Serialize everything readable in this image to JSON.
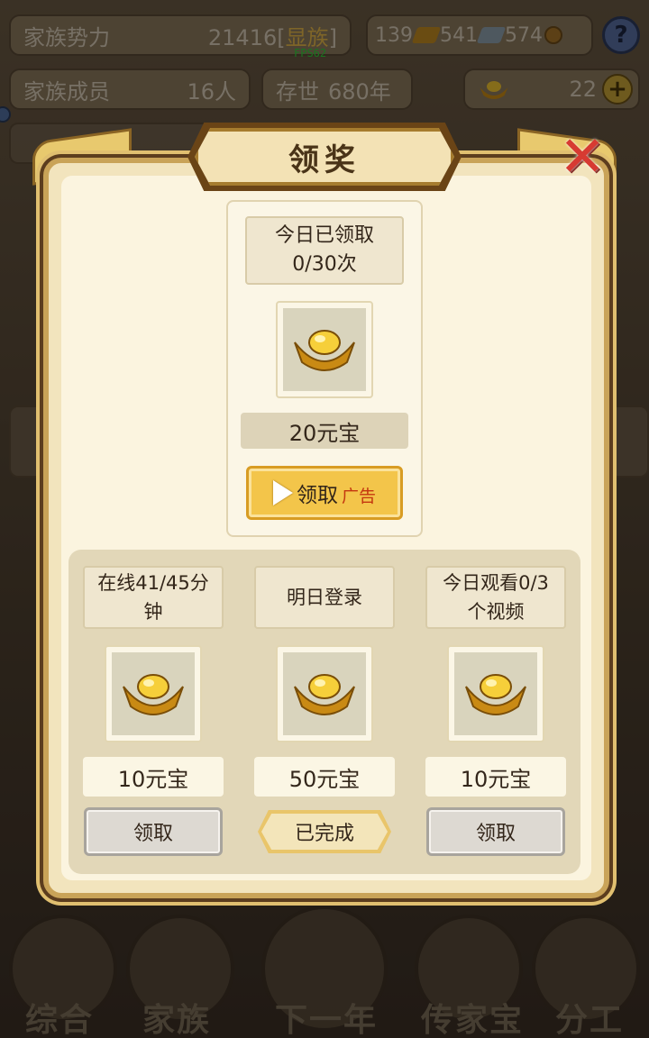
{
  "status": {
    "family_power_label": "家族势力",
    "family_power_value": "21416",
    "family_power_rank": "显族",
    "res_gold": "139",
    "res_silver": "541",
    "res_coin": "574",
    "members_label": "家族成员",
    "members_value": "16人",
    "existence_label": "存世",
    "existence_value": "680年",
    "ingot_count": "22",
    "fps": "FPS62"
  },
  "modal": {
    "title": "领奖",
    "main": {
      "today_claimed": "今日已领取",
      "today_count": "0/30次",
      "reward": "20元宝",
      "button_label": "领取",
      "button_tag": "广告"
    },
    "tasks": [
      {
        "line1": "在线41/45分",
        "line2": "钟",
        "reward": "10元宝",
        "action": "领取",
        "status": "available"
      },
      {
        "line1": "明日登录",
        "line2": "",
        "reward": "50元宝",
        "action": "已完成",
        "status": "done"
      },
      {
        "line1": "今日观看0/3",
        "line2": "个视频",
        "reward": "10元宝",
        "action": "领取",
        "status": "available"
      }
    ]
  },
  "nav": {
    "items": [
      "综合",
      "家族",
      "下一年",
      "传家宝",
      "分工"
    ]
  },
  "colors": {
    "accent_gold": "#f3c54a",
    "frame_brown": "#6a4416",
    "close_red": "#d73a32"
  },
  "icons": [
    "help-icon",
    "gold-ingot-icon",
    "plus-icon",
    "close-icon",
    "play-icon"
  ]
}
